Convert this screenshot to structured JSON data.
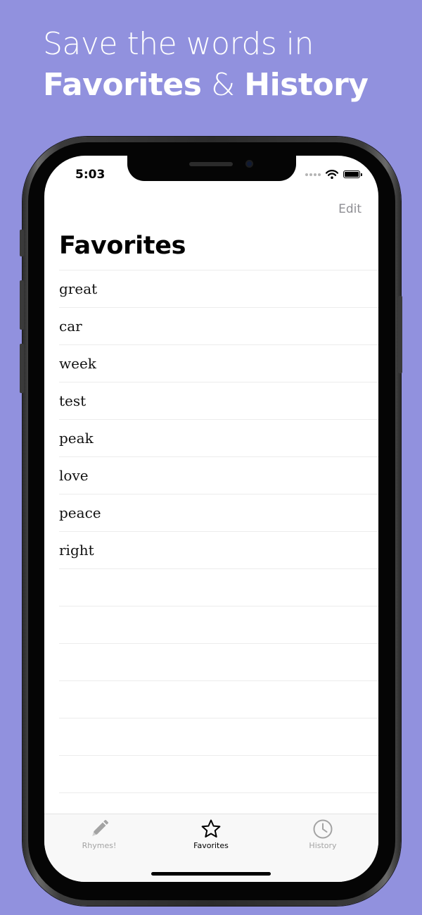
{
  "promo": {
    "line1": "Save the words in",
    "bold1": "Favorites",
    "amp": "&",
    "bold2": "History"
  },
  "status_bar": {
    "time": "5:03"
  },
  "nav": {
    "edit_label": "Edit",
    "title": "Favorites"
  },
  "favorites": [
    "great",
    "car",
    "week",
    "test",
    "peak",
    "love",
    "peace",
    "right",
    "",
    "",
    "",
    "",
    "",
    "",
    ""
  ],
  "tabbar": {
    "tabs": [
      {
        "label": "Rhymes!",
        "icon": "pencil-icon",
        "active": false
      },
      {
        "label": "Favorites",
        "icon": "star-icon",
        "active": true
      },
      {
        "label": "History",
        "icon": "clock-icon",
        "active": false
      }
    ]
  },
  "colors": {
    "background": "#9191de",
    "tab_inactive": "#a3a3a3",
    "tab_active": "#000000",
    "edit": "#8e8e93"
  }
}
